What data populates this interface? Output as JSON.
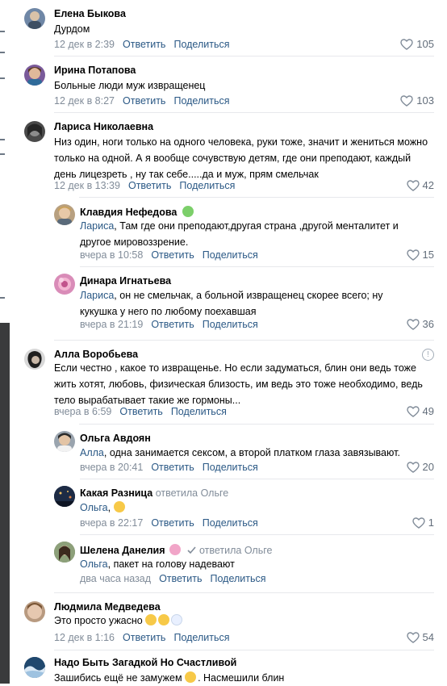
{
  "comments": [
    {
      "author": "Елена Быкова",
      "text": "Дурдом",
      "time": "12 дек в 2:39",
      "likes": "105"
    },
    {
      "author": "Ирина Потапова",
      "text": "Больные люди муж извращенец",
      "time": "12 дек в 8:27",
      "likes": "103"
    },
    {
      "author": "Лариса Николаевна",
      "text": "Низ один, ноги только на одного человека, руки тоже, значит и жениться можно только на одной. А я вообще сочувствую детям, где они преподают, каждый день лицезреть , ну так себе.....да и муж, прям смельчак",
      "time": "12 дек в 13:39",
      "likes": "42",
      "replies": [
        {
          "author": "Клавдия Нефедова",
          "ref": "Лариса",
          "text": ", Там где они преподают,другая страна ,другой менталитет и другое мировоззрение.",
          "time": "вчера в 10:58",
          "likes": "15"
        },
        {
          "author": "Динара Игнатьева",
          "ref": "Лариса",
          "text": ", он не смельчак, а больной извращенец скорее всего; ну кукушка у него по любому поехавшая",
          "time": "вчера в 21:19",
          "likes": "36"
        }
      ]
    },
    {
      "author": "Алла Воробьева",
      "text": "Если честно , какое то извращенье. Но если задуматься, блин они ведь тоже жить хотят, любовь, физическая близость, им ведь это тоже необходимо, ведь тело вырабатывает такие же гормоны...",
      "time": "вчера в 6:59",
      "likes": "49",
      "replies": [
        {
          "author": "Ольга Авдоян",
          "ref": "Алла",
          "text": ", одна занимается сексом, а второй платком глаза завязывают.",
          "time": "вчера в 20:41",
          "likes": "20"
        },
        {
          "author": "Какая Разница",
          "replied": "ответила Ольге",
          "ref": "Ольга",
          "text": ",",
          "time": "вчера в 22:17",
          "likes": "1"
        },
        {
          "author": "Шелена Данелия",
          "replied": "ответила Ольге",
          "ref": "Ольга",
          "text": ", пакет на голову надевают",
          "time": "два часа назад",
          "likes": ""
        }
      ]
    },
    {
      "author": "Людмила Медведева",
      "text": "Это просто ужасно",
      "time": "12 дек в 1:16",
      "likes": "54"
    },
    {
      "author": "Надо Быть Загадкой Но Счастливой",
      "text": "Зашибись ещё не замужем",
      "text2": ". Насмешили блин",
      "time": "",
      "likes": ""
    }
  ],
  "actions": {
    "reply": "Ответить",
    "share": "Поделиться"
  },
  "colors": {
    "link": "#2a5885",
    "meta": "#818c99",
    "likes": "#626d7a"
  },
  "icons": [
    "heart-icon",
    "report-icon",
    "verified-check-icon"
  ]
}
